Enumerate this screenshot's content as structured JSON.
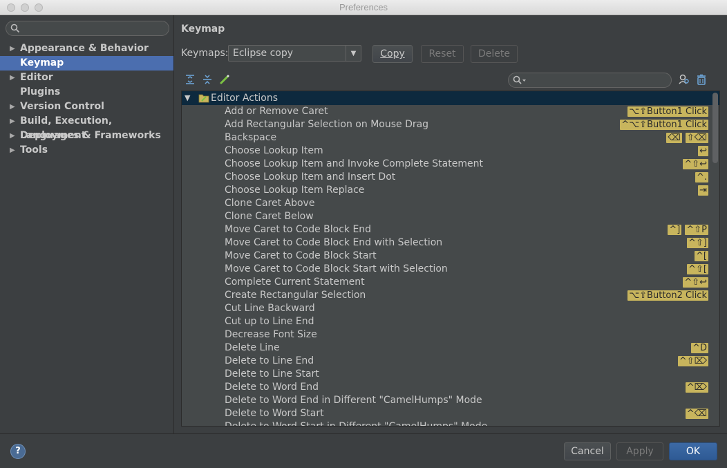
{
  "window": {
    "title": "Preferences"
  },
  "sidebar": {
    "items": [
      {
        "label": "Appearance & Behavior",
        "expandable": true,
        "selected": false
      },
      {
        "label": "Keymap",
        "expandable": false,
        "selected": true
      },
      {
        "label": "Editor",
        "expandable": true,
        "selected": false
      },
      {
        "label": "Plugins",
        "expandable": false,
        "selected": false
      },
      {
        "label": "Version Control",
        "expandable": true,
        "selected": false
      },
      {
        "label": "Build, Execution, Deployment",
        "expandable": true,
        "selected": false
      },
      {
        "label": "Languages & Frameworks",
        "expandable": true,
        "selected": false
      },
      {
        "label": "Tools",
        "expandable": true,
        "selected": false
      }
    ]
  },
  "main": {
    "title": "Keymap",
    "keymaps_label": "Keymaps:",
    "keymap_value": "Eclipse copy",
    "buttons": {
      "copy": "Copy",
      "reset": "Reset",
      "delete": "Delete"
    }
  },
  "actions": {
    "group": "Editor Actions",
    "rows": [
      {
        "name": "Add or Remove Caret",
        "shortcuts": [
          "⌥⇧Button1 Click"
        ]
      },
      {
        "name": "Add Rectangular Selection on Mouse Drag",
        "shortcuts": [
          "^⌥⇧Button1 Click"
        ]
      },
      {
        "name": "Backspace",
        "shortcuts": [
          "⌫",
          "⇧⌫"
        ]
      },
      {
        "name": "Choose Lookup Item",
        "shortcuts": [
          "↩"
        ]
      },
      {
        "name": "Choose Lookup Item and Invoke Complete Statement",
        "shortcuts": [
          "^⇧↩"
        ]
      },
      {
        "name": "Choose Lookup Item and Insert Dot",
        "shortcuts": [
          "^."
        ]
      },
      {
        "name": "Choose Lookup Item Replace",
        "shortcuts": [
          "⇥"
        ]
      },
      {
        "name": "Clone Caret Above",
        "shortcuts": []
      },
      {
        "name": "Clone Caret Below",
        "shortcuts": []
      },
      {
        "name": "Move Caret to Code Block End",
        "shortcuts": [
          "^]",
          "^⇧P"
        ]
      },
      {
        "name": "Move Caret to Code Block End with Selection",
        "shortcuts": [
          "^⇧]"
        ]
      },
      {
        "name": "Move Caret to Code Block Start",
        "shortcuts": [
          "^["
        ]
      },
      {
        "name": "Move Caret to Code Block Start with Selection",
        "shortcuts": [
          "^⇧["
        ]
      },
      {
        "name": "Complete Current Statement",
        "shortcuts": [
          "^⇧↩"
        ]
      },
      {
        "name": "Create Rectangular Selection",
        "shortcuts": [
          "⌥⇧Button2 Click"
        ]
      },
      {
        "name": "Cut Line Backward",
        "shortcuts": []
      },
      {
        "name": "Cut up to Line End",
        "shortcuts": []
      },
      {
        "name": "Decrease Font Size",
        "shortcuts": []
      },
      {
        "name": "Delete Line",
        "shortcuts": [
          "^D"
        ]
      },
      {
        "name": "Delete to Line End",
        "shortcuts": [
          "^⇧⌦"
        ]
      },
      {
        "name": "Delete to Line Start",
        "shortcuts": []
      },
      {
        "name": "Delete to Word End",
        "shortcuts": [
          "^⌦"
        ]
      },
      {
        "name": "Delete to Word End in Different \"CamelHumps\" Mode",
        "shortcuts": []
      },
      {
        "name": "Delete to Word Start",
        "shortcuts": [
          "^⌫"
        ]
      },
      {
        "name": "Delete to Word Start in Different \"CamelHumps\" Mode",
        "shortcuts": []
      }
    ]
  },
  "footer": {
    "help": "?",
    "cancel": "Cancel",
    "apply": "Apply",
    "ok": "OK"
  }
}
